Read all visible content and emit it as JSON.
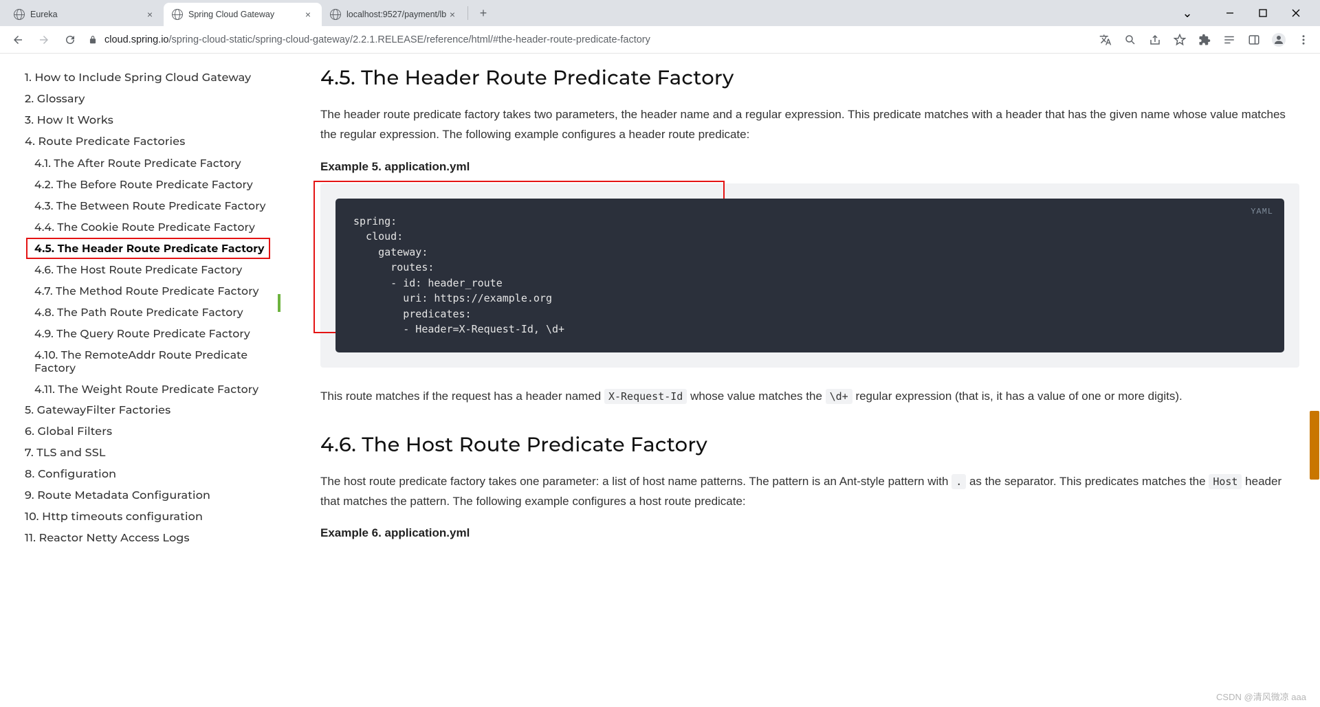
{
  "tabs": [
    {
      "title": "Eureka"
    },
    {
      "title": "Spring Cloud Gateway"
    },
    {
      "title": "localhost:9527/payment/lb"
    }
  ],
  "address": {
    "host": "cloud.spring.io",
    "path": "/spring-cloud-static/spring-cloud-gateway/2.2.1.RELEASE/reference/html/#the-header-route-predicate-factory"
  },
  "toc": [
    {
      "n": "1.",
      "t": "How to Include Spring Cloud Gateway",
      "sub": false
    },
    {
      "n": "2.",
      "t": "Glossary",
      "sub": false
    },
    {
      "n": "3.",
      "t": "How It Works",
      "sub": false
    },
    {
      "n": "4.",
      "t": "Route Predicate Factories",
      "sub": false
    },
    {
      "n": "4.1.",
      "t": "The After Route Predicate Factory",
      "sub": true
    },
    {
      "n": "4.2.",
      "t": "The Before Route Predicate Factory",
      "sub": true
    },
    {
      "n": "4.3.",
      "t": "The Between Route Predicate Factory",
      "sub": true
    },
    {
      "n": "4.4.",
      "t": "The Cookie Route Predicate Factory",
      "sub": true
    },
    {
      "n": "4.5.",
      "t": "The Header Route Predicate Factory",
      "sub": true,
      "current": true
    },
    {
      "n": "4.6.",
      "t": "The Host Route Predicate Factory",
      "sub": true
    },
    {
      "n": "4.7.",
      "t": "The Method Route Predicate Factory",
      "sub": true
    },
    {
      "n": "4.8.",
      "t": "The Path Route Predicate Factory",
      "sub": true
    },
    {
      "n": "4.9.",
      "t": "The Query Route Predicate Factory",
      "sub": true
    },
    {
      "n": "4.10.",
      "t": "The RemoteAddr Route Predicate Factory",
      "sub": true
    },
    {
      "n": "4.11.",
      "t": "The Weight Route Predicate Factory",
      "sub": true
    },
    {
      "n": "5.",
      "t": "GatewayFilter Factories",
      "sub": false
    },
    {
      "n": "6.",
      "t": "Global Filters",
      "sub": false
    },
    {
      "n": "7.",
      "t": "TLS and SSL",
      "sub": false
    },
    {
      "n": "8.",
      "t": "Configuration",
      "sub": false
    },
    {
      "n": "9.",
      "t": "Route Metadata Configuration",
      "sub": false
    },
    {
      "n": "10.",
      "t": "Http timeouts configuration",
      "sub": false
    },
    {
      "n": "11.",
      "t": "Reactor Netty Access Logs",
      "sub": false
    }
  ],
  "sec45": {
    "heading": "4.5. The Header Route Predicate Factory",
    "p1": "The header route predicate factory takes two parameters, the header name and a regular expression. This predicate matches with a header that has the given name whose value matches the regular expression. The following example configures a header route predicate:",
    "example_title": "Example 5. application.yml",
    "code_lang": "YAML",
    "code": "spring:\n  cloud:\n    gateway:\n      routes:\n      - id: header_route\n        uri: https://example.org\n        predicates:\n        - Header=X-Request-Id, \\d+",
    "p2a": "This route matches if the request has a header named ",
    "p2code1": "X-Request-Id",
    "p2b": " whose value matches the ",
    "p2code2": "\\d+",
    "p2c": " regular expression (that is, it has a value of one or more digits)."
  },
  "sec46": {
    "heading": "4.6. The Host Route Predicate Factory",
    "p1a": "The host route predicate factory takes one parameter: a list of host name patterns. The pattern is an Ant-style pattern with ",
    "p1code": ".",
    "p1b": " as the separator. This predicates matches the ",
    "p1code2": "Host",
    "p1c": " header that matches the pattern. The following example configures a host route predicate:",
    "example_title": "Example 6. application.yml"
  },
  "watermark": "CSDN @清风微凉 aaa"
}
